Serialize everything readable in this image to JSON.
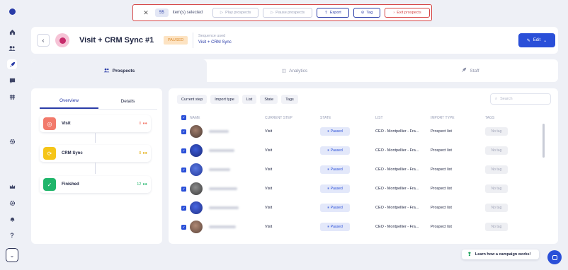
{
  "rail": {
    "icons": [
      "logo-icon",
      "home-icon",
      "users-icon",
      "rocket-icon",
      "chat-icon",
      "grid-icon",
      "settings-icon",
      "crown-icon",
      "gear-icon",
      "bell-icon",
      "help-icon",
      "expand-icon"
    ],
    "help_glyph": "?",
    "expand_glyph": "⌄"
  },
  "selection": {
    "close": "✕",
    "count": "55",
    "label": "item(s) selected",
    "buttons": {
      "play": "Play prospects",
      "pause": "Pause prospects",
      "export": "Export",
      "tag": "Tag",
      "exit": "Exit prospects"
    }
  },
  "header": {
    "back": "‹",
    "title": "Visit + CRM Sync #1",
    "status": "PAUSED",
    "sequence_label": "Sequence used",
    "sequence_name": "Visit + CRM Sync",
    "edit": "Edit"
  },
  "tabs": {
    "prospects": "Prospects",
    "analytics": "Analytics",
    "staff": "Staff"
  },
  "left": {
    "subtabs": {
      "overview": "Overview",
      "details": "Details"
    },
    "steps": [
      {
        "name": "Visit",
        "count": "0",
        "color": "#f27a6b"
      },
      {
        "name": "CRM Sync",
        "count": "0",
        "color": "#f5c518"
      },
      {
        "name": "Finished",
        "count": "12",
        "color": "#1fb56a"
      }
    ]
  },
  "table": {
    "filters": {
      "current_step": "Current step",
      "import_type": "Import type",
      "list": "List",
      "state": "State",
      "tags": "Tags"
    },
    "search_placeholder": "Search",
    "columns": {
      "name": "NAME",
      "current_step": "CURRENT STEP",
      "state": "STATE",
      "list": "LIST",
      "import_type": "IMPORT TYPE",
      "tags": "TAGS"
    },
    "rows": [
      {
        "step": "Visit",
        "state": "Paused",
        "list": "CEO - Montpellier - Fra...",
        "import_type": "Prospect list",
        "tags": "No tag"
      },
      {
        "step": "Visit",
        "state": "Paused",
        "list": "CEO - Montpellier - Fra...",
        "import_type": "Prospect list",
        "tags": "No tag"
      },
      {
        "step": "Visit",
        "state": "Paused",
        "list": "CEO - Montpellier - Fra...",
        "import_type": "Prospect list",
        "tags": "No tag"
      },
      {
        "step": "Visit",
        "state": "Paused",
        "list": "CEO - Montpellier - Fra...",
        "import_type": "Prospect list",
        "tags": "No tag"
      },
      {
        "step": "Visit",
        "state": "Paused",
        "list": "CEO - Montpellier - Fra...",
        "import_type": "Prospect list",
        "tags": "No tag"
      },
      {
        "step": "Visit",
        "state": "Paused",
        "list": "CEO - Montpellier - Fra...",
        "import_type": "Prospect list",
        "tags": "No tag"
      }
    ]
  },
  "footer": {
    "learn": "Learn how a campaign works!"
  },
  "colors": {
    "accent": "#2a4fd8",
    "danger": "#d64545",
    "paused_bg": "#fde3c2"
  }
}
